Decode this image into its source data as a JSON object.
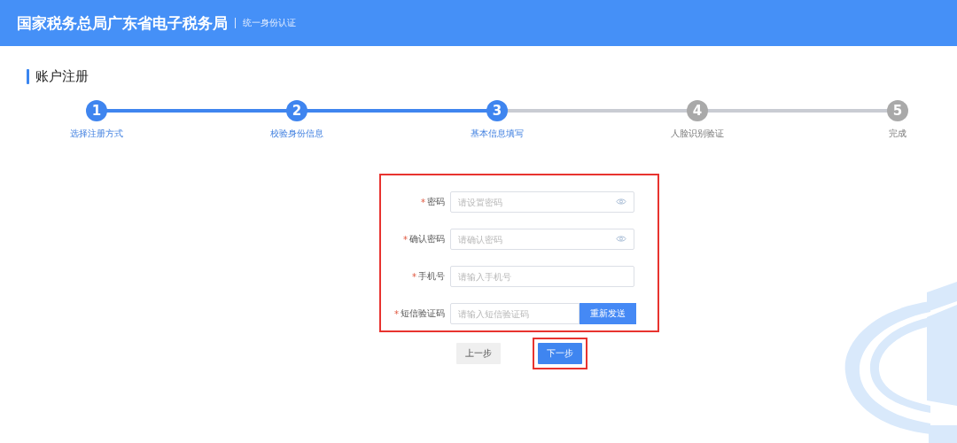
{
  "header": {
    "title": "国家税务总局广东省电子税务局",
    "subtitle": "统一身份认证"
  },
  "section_title": "账户注册",
  "steps": [
    {
      "number": "1",
      "label": "选择注册方式",
      "completed": true
    },
    {
      "number": "2",
      "label": "校验身份信息",
      "completed": true
    },
    {
      "number": "3",
      "label": "基本信息填写",
      "completed": true
    },
    {
      "number": "4",
      "label": "人脸识别验证",
      "completed": false
    },
    {
      "number": "5",
      "label": "完成",
      "completed": false
    }
  ],
  "form": {
    "highlighted": true,
    "fields": [
      {
        "kind": "password",
        "required": true,
        "required_mark": "*",
        "label": "密码",
        "placeholder": "请设置密码"
      },
      {
        "kind": "password",
        "required": true,
        "required_mark": "*",
        "label": "确认密码",
        "placeholder": "请确认密码"
      },
      {
        "kind": "text",
        "required": true,
        "required_mark": "*",
        "label": "手机号",
        "placeholder": "请输入手机号"
      },
      {
        "kind": "sms",
        "required": true,
        "required_mark": "*",
        "label": "短信验证码",
        "placeholder": "请输入短信验证码",
        "button": "重新发送"
      }
    ]
  },
  "buttons": [
    {
      "kind": "secondary",
      "label": "上一步",
      "highlighted": false
    },
    {
      "kind": "primary",
      "label": "下一步",
      "highlighted": true
    }
  ]
}
